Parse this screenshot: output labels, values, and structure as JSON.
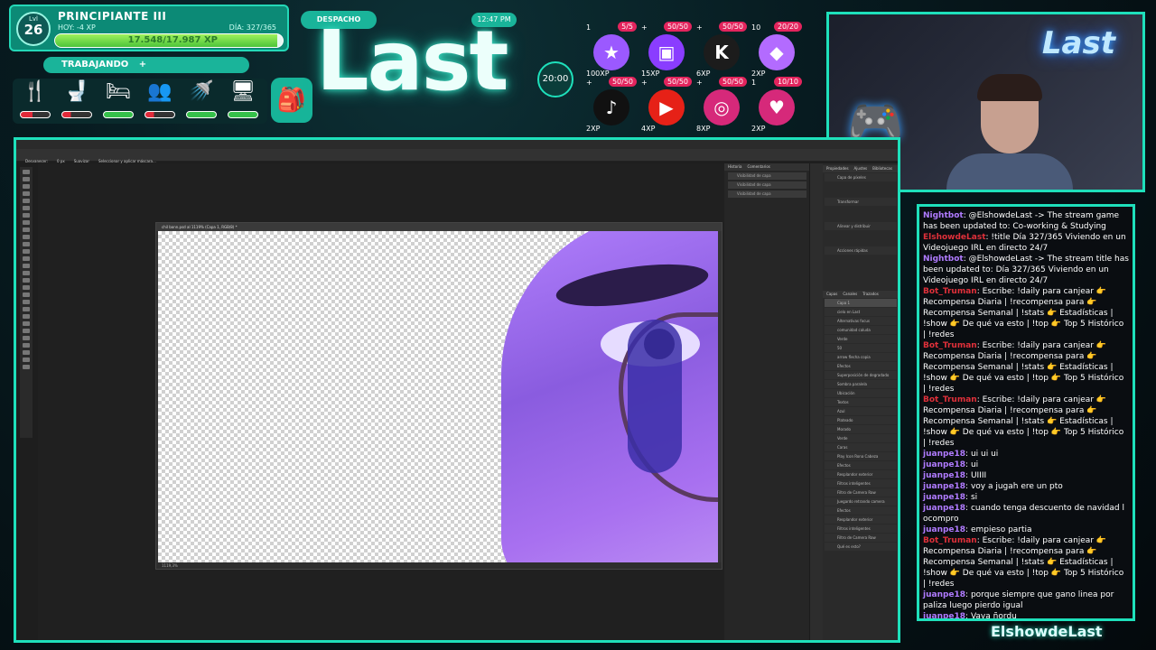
{
  "level": {
    "label": "Lvl",
    "number": "26",
    "title": "PRINCIPIANTE III",
    "today": "HOY: -4 XP",
    "day": "DÍA: 327/365",
    "xp_text": "17.548/17.987 XP",
    "xp_fraction": 0.976
  },
  "status": {
    "despacho": "DESPACHO",
    "clock": "12:47 PM",
    "trabajando": "TRABAJANDO",
    "trabajando_plus": "+",
    "timer": "20:00"
  },
  "logo": {
    "text": "Last"
  },
  "needs": [
    {
      "icon": "utensils-icon",
      "glyph": "🍴",
      "bar_color": "#e02a3a",
      "level": 0.4
    },
    {
      "icon": "toilet-icon",
      "glyph": "🚽",
      "bar_color": "#e02a3a",
      "level": 0.3
    },
    {
      "icon": "bed-icon",
      "glyph": "🛏",
      "bar_color": "#35c04a",
      "level": 1.0
    },
    {
      "icon": "social-icon",
      "glyph": "👥",
      "bar_color": "#e02a3a",
      "level": 0.3
    },
    {
      "icon": "shower-icon",
      "glyph": "🚿",
      "bar_color": "#35c04a",
      "level": 1.0
    },
    {
      "icon": "fun-icon",
      "glyph": "🖥",
      "bar_color": "#35c04a",
      "level": 1.0
    }
  ],
  "backpack": {
    "icon": "backpack-icon",
    "glyph": "🎒"
  },
  "goals": [
    {
      "name": "star",
      "glyph": "★",
      "mini": "1",
      "count": "5/5",
      "xp": "100XP",
      "color": "#9b59ff"
    },
    {
      "name": "twitch",
      "glyph": "▣",
      "mini": "+",
      "count": "50/50",
      "xp": "15XP",
      "color": "#8a3dff"
    },
    {
      "name": "kick",
      "glyph": "K",
      "mini": "+",
      "count": "50/50",
      "xp": "6XP",
      "color": "#1c1c1c"
    },
    {
      "name": "gem",
      "glyph": "◆",
      "mini": "10",
      "count": "20/20",
      "xp": "2XP",
      "color": "#b36bff"
    },
    {
      "name": "tiktok",
      "glyph": "♪",
      "mini": "+",
      "count": "50/50",
      "xp": "2XP",
      "color": "#111"
    },
    {
      "name": "youtube",
      "glyph": "▶",
      "mini": "+",
      "count": "50/50",
      "xp": "4XP",
      "color": "#e62117"
    },
    {
      "name": "instagram",
      "glyph": "◎",
      "mini": "+",
      "count": "50/50",
      "xp": "8XP",
      "color": "#d6297a"
    },
    {
      "name": "heart",
      "glyph": "♥",
      "mini": "1",
      "count": "10/10",
      "xp": "2XP",
      "color": "#d6297a"
    }
  ],
  "webcam": {
    "sign": "Last"
  },
  "photoshop": {
    "menu": [
      "Archivo",
      "Edición",
      "Imagen",
      "Capa",
      "Texto",
      "Selección",
      "Filtro",
      "3D",
      "Vista",
      "Plugins",
      "Ventana",
      "Ayuda"
    ],
    "options": [
      "Desvanecer:",
      "0 px",
      "Suavizar",
      "Seleccionar y aplicar máscara..."
    ],
    "doc_tab": "chil bonn.psd al 1119% (Capa 1, RGB/8) *",
    "doc_status": "1119,3%",
    "history_tabs": [
      "Historia",
      "Comentarios"
    ],
    "history_items": [
      "Visibilidad de capa",
      "Visibilidad de capa",
      "Visibilidad de capa"
    ],
    "props_tabs": [
      "Propiedades",
      "Ajustes",
      "Bibliotecas"
    ],
    "props_rows": [
      "Capa de píxeles",
      "Transformar",
      "Alinear y distribuir",
      "Acciones rápidas"
    ],
    "layers_tabs": [
      "Capas",
      "Canales",
      "Trazados"
    ],
    "layers": [
      "Capa 1",
      "cielo en Last",
      "Alternativas focus",
      "comunidad caluda",
      "Verde",
      "50",
      "arrow flecha copia",
      "Efectos",
      "Superposición de degradado",
      "Sombra paralela",
      "Ubicación",
      "Textos",
      "Azul",
      "Plateado",
      "Morado",
      "Verde",
      "Caras",
      "Play Icon Rona Cabeza",
      "Efectos",
      "Resplandor exterior",
      "Filtros inteligentes",
      "Filtro de Camera Raw",
      "Juegardo retrando camera",
      "Efectos",
      "Resplandor exterior",
      "Filtros inteligentes",
      "Filtro de Camera Raw",
      "Qué es esto?"
    ]
  },
  "chat": [
    {
      "user": "Nightbot",
      "color": "#b07bff",
      "text": "@ElshowdeLast -> The stream game has been updated to: Co-working & Studying"
    },
    {
      "user": "ElshowdeLast",
      "color": "#e0303a",
      "text": "!title Día 327/365 Viviendo en un Videojuego IRL en directo 24/7"
    },
    {
      "user": "Nightbot",
      "color": "#b07bff",
      "text": "@ElshowdeLast -> The stream title has been updated to: Día 327/365 Viviendo en un Videojuego IRL en directo 24/7"
    },
    {
      "user": "Bot_Truman",
      "color": "#e0303a",
      "text": "Escribe: !daily para canjear 👉 Recompensa Diaria | !recompensa para 👉 Recompensa Semanal | !stats 👉 Estadísticas | !show 👉 De qué va esto | !top 👉 Top 5 Histórico | !redes"
    },
    {
      "user": "Bot_Truman",
      "color": "#e0303a",
      "text": "Escribe: !daily para canjear 👉 Recompensa Diaria | !recompensa para 👉 Recompensa Semanal | !stats 👉 Estadísticas | !show 👉 De qué va esto | !top 👉 Top 5 Histórico | !redes"
    },
    {
      "user": "Bot_Truman",
      "color": "#e0303a",
      "text": "Escribe: !daily para canjear 👉 Recompensa Diaria | !recompensa para 👉 Recompensa Semanal | !stats 👉 Estadísticas | !show 👉 De qué va esto | !top 👉 Top 5 Histórico | !redes"
    },
    {
      "user": "juanpe18",
      "color": "#b07bff",
      "text": "ui ui ui"
    },
    {
      "user": "juanpe18",
      "color": "#b07bff",
      "text": "ui"
    },
    {
      "user": "juanpe18",
      "color": "#b07bff",
      "text": "UIIII"
    },
    {
      "user": "juanpe18",
      "color": "#b07bff",
      "text": "voy a jugah ere un pto"
    },
    {
      "user": "juanpe18",
      "color": "#b07bff",
      "text": "si"
    },
    {
      "user": "juanpe18",
      "color": "#b07bff",
      "text": "cuando tenga descuento de navidad l ocompro"
    },
    {
      "user": "juanpe18",
      "color": "#b07bff",
      "text": "empieso partia"
    },
    {
      "user": "Bot_Truman",
      "color": "#e0303a",
      "text": "Escribe: !daily para canjear 👉 Recompensa Diaria | !recompensa para 👉 Recompensa Semanal | !stats 👉 Estadísticas | !show 👉 De qué va esto | !top 👉 Top 5 Histórico | !redes"
    },
    {
      "user": "juanpe18",
      "color": "#b07bff",
      "text": "porque siempre que gano linea por paliza luego pierdo igual"
    },
    {
      "user": "juanpe18",
      "color": "#b07bff",
      "text": "Vaya ñordu"
    }
  ],
  "watermark": "ElshowdeLast"
}
